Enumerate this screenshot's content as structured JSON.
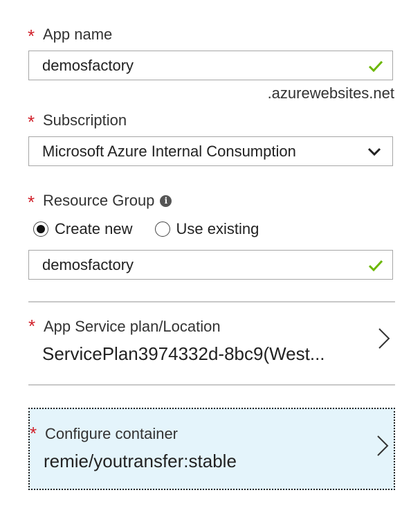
{
  "app_name": {
    "label": "App name",
    "value": "demosfactory",
    "suffix": ".azurewebsites.net"
  },
  "subscription": {
    "label": "Subscription",
    "value": "Microsoft Azure Internal Consumption"
  },
  "resource_group": {
    "label": "Resource Group",
    "options": [
      "Create new",
      "Use existing"
    ],
    "selected": "Create new",
    "value": "demosfactory"
  },
  "service_plan": {
    "label": "App Service plan/Location",
    "value": "ServicePlan3974332d-8bc9(West..."
  },
  "container": {
    "label": "Configure container",
    "value": "remie/youtransfer:stable"
  },
  "required_marker": "*",
  "colors": {
    "required": "#d1202a",
    "valid_check": "#6bb700",
    "selected_blade_bg": "#e4f4fb"
  }
}
